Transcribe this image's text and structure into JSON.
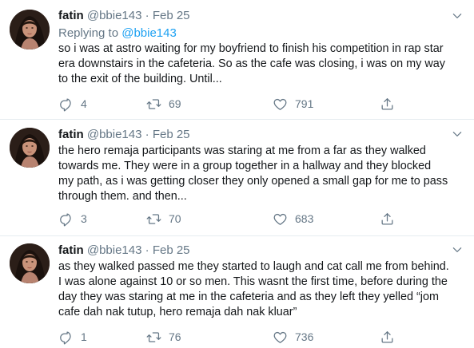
{
  "colors": {
    "accent": "#1da1f2",
    "muted": "#657786",
    "text": "#14171a",
    "divider": "#e6ecf0"
  },
  "tweets": [
    {
      "name": "fatin",
      "handle": "@bbie143",
      "dot": "·",
      "date": "Feb 25",
      "replying_prefix": "Replying to",
      "replying_to": "@bbie143",
      "lines": [
        "so i was at astro waiting for my boyfriend to finish his competition in rap star",
        "era downstairs in the cafeteria. So as the cafe was closing, i was on my way",
        "to the exit of the building. Until..."
      ],
      "replies": "4",
      "retweets": "69",
      "likes": "791"
    },
    {
      "name": "fatin",
      "handle": "@bbie143",
      "dot": "·",
      "date": "Feb 25",
      "lines": [
        "the hero remaja participants was staring at me from a far as they walked",
        "towards me. They were in a group together in a hallway and they blocked",
        "my path, as i was getting closer they only opened a small gap for me to pass",
        "through them. and then..."
      ],
      "replies": "3",
      "retweets": "70",
      "likes": "683"
    },
    {
      "name": "fatin",
      "handle": "@bbie143",
      "dot": "·",
      "date": "Feb 25",
      "lines": [
        "as they walked passed me they started to laugh and cat call me from behind.",
        "I was alone against 10 or so men. This wasnt the first time, before during the",
        "day they was staring at me in the cafeteria and as they left they yelled “jom",
        "cafe dah nak tutup, hero remaja dah nak kluar”"
      ],
      "replies": "1",
      "retweets": "76",
      "likes": "736"
    }
  ]
}
